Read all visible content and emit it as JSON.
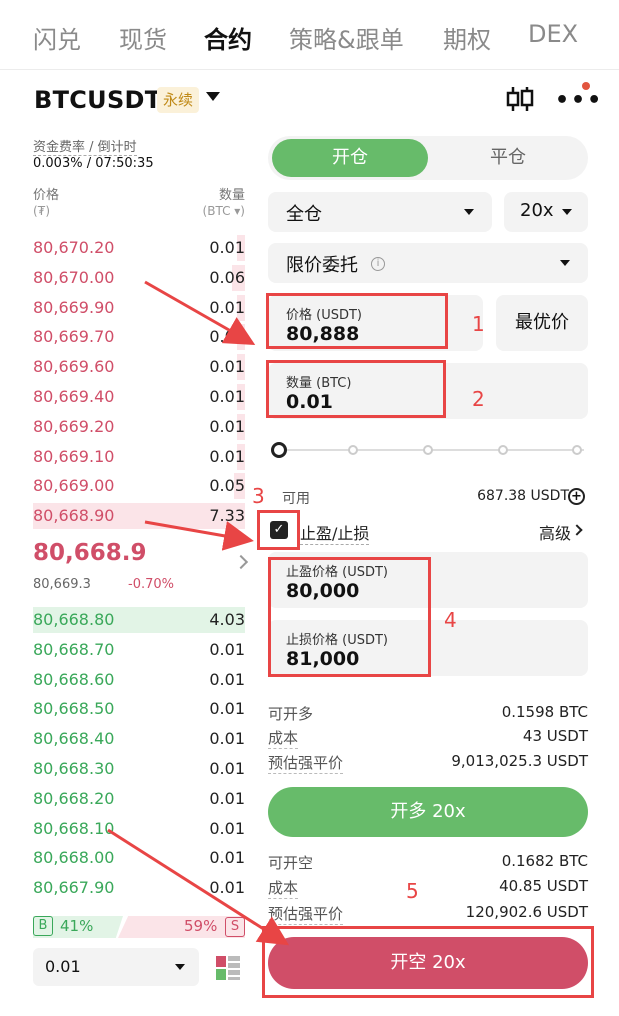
{
  "nav": {
    "tabs": [
      "闪兑",
      "现货",
      "合约",
      "策略&跟单",
      "期权",
      "DEX"
    ],
    "active": "合约"
  },
  "header": {
    "symbol": "BTCUSDT",
    "badge": "永续"
  },
  "funding": {
    "label": "资金费率 / 倒计时",
    "value": "0.003% / 07:50:35"
  },
  "orderbook": {
    "price_label": "价格",
    "price_unit": "(₮)",
    "qty_label": "数量",
    "qty_unit": "(BTC ▾)",
    "asks": [
      {
        "price": "80,670.20",
        "qty": "0.01",
        "depth": 0.04
      },
      {
        "price": "80,670.00",
        "qty": "0.06",
        "depth": 0.06
      },
      {
        "price": "80,669.90",
        "qty": "0.01",
        "depth": 0.04
      },
      {
        "price": "80,669.70",
        "qty": "0.01",
        "depth": 0.04
      },
      {
        "price": "80,669.60",
        "qty": "0.01",
        "depth": 0.04
      },
      {
        "price": "80,669.40",
        "qty": "0.01",
        "depth": 0.04
      },
      {
        "price": "80,669.20",
        "qty": "0.01",
        "depth": 0.04
      },
      {
        "price": "80,669.10",
        "qty": "0.01",
        "depth": 0.04
      },
      {
        "price": "80,669.00",
        "qty": "0.05",
        "depth": 0.05
      },
      {
        "price": "80,668.90",
        "qty": "7.33",
        "depth": 1.0
      }
    ],
    "last_price": "80,668.9",
    "mark_price": "80,669.3",
    "change": "-0.70%",
    "bids": [
      {
        "price": "80,668.80",
        "qty": "4.03",
        "depth": 1.0
      },
      {
        "price": "80,668.70",
        "qty": "0.01",
        "depth": 0.0
      },
      {
        "price": "80,668.60",
        "qty": "0.01",
        "depth": 0.0
      },
      {
        "price": "80,668.50",
        "qty": "0.01",
        "depth": 0.0
      },
      {
        "price": "80,668.40",
        "qty": "0.01",
        "depth": 0.0
      },
      {
        "price": "80,668.30",
        "qty": "0.01",
        "depth": 0.0
      },
      {
        "price": "80,668.20",
        "qty": "0.01",
        "depth": 0.0
      },
      {
        "price": "80,668.10",
        "qty": "0.01",
        "depth": 0.0
      },
      {
        "price": "80,668.00",
        "qty": "0.01",
        "depth": 0.0
      },
      {
        "price": "80,667.90",
        "qty": "0.01",
        "depth": 0.0
      }
    ],
    "buy_letter": "B",
    "buy_ratio": "41%",
    "sell_ratio": "59%",
    "sell_letter": "S",
    "precision": "0.01"
  },
  "form": {
    "tab_open": "开仓",
    "tab_close": "平仓",
    "margin_mode": "全仓",
    "leverage": "20x",
    "order_type": "限价委托",
    "price_label": "价格 (USDT)",
    "price_value": "80,888",
    "best_price": "最优价",
    "qty_label": "数量 (BTC)",
    "qty_value": "0.01",
    "slider_fraction": 0,
    "available_label": "可用",
    "available_value": "687.38 USDT",
    "tpsl_label": "止盈/止损",
    "tpsl_checked": true,
    "advanced_label": "高级",
    "tp_label": "止盈价格 (USDT)",
    "tp_value": "80,000",
    "sl_label": "止损价格 (USDT)",
    "sl_value": "81,000"
  },
  "long_summary": {
    "open_label": "可开多",
    "open_value": "0.1598 BTC",
    "cost_label": "成本",
    "cost_value": "43 USDT",
    "liq_label": "预估强平价",
    "liq_value": "9,013,025.3 USDT"
  },
  "long_button": "开多 20x",
  "short_summary": {
    "open_label": "可开空",
    "open_value": "0.1682 BTC",
    "cost_label": "成本",
    "cost_value": "40.85 USDT",
    "liq_label": "预估强平价",
    "liq_value": "120,902.6 USDT"
  },
  "short_button": "开空 20x",
  "annotations": [
    "1",
    "2",
    "3",
    "4",
    "5"
  ],
  "colors": {
    "long": "#67bb6a",
    "short": "#d04e68",
    "annotation": "#e84545"
  }
}
